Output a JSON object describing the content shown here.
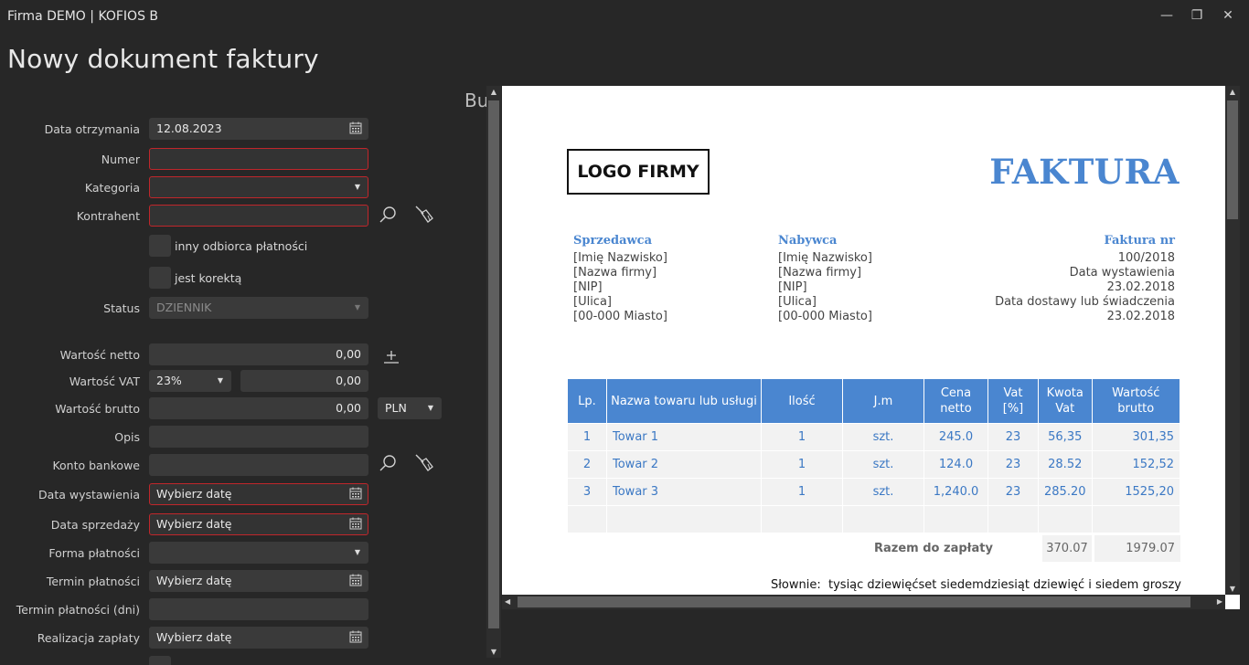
{
  "window": {
    "title": "Firma DEMO | KOFIOS B",
    "minimize": "—",
    "restore": "❐",
    "close": "✕"
  },
  "page": {
    "title": "Nowy dokument faktury",
    "preview_heading": "Bu"
  },
  "form": {
    "data_otrzymania": {
      "label": "Data otrzymania",
      "value": "12.08.2023"
    },
    "numer": {
      "label": "Numer",
      "value": ""
    },
    "kategoria": {
      "label": "Kategoria",
      "value": ""
    },
    "kontrahent": {
      "label": "Kontrahent",
      "value": ""
    },
    "inny_odbiorca": {
      "label": "inny odbiorca płatności"
    },
    "jest_korekta": {
      "label": "jest korektą"
    },
    "status": {
      "label": "Status",
      "value": "DZIENNIK"
    },
    "wartosc_netto": {
      "label": "Wartość netto",
      "value": "0,00"
    },
    "wartosc_vat": {
      "label": "Wartość VAT",
      "rate": "23%",
      "value": "0,00"
    },
    "wartosc_brutto": {
      "label": "Wartość brutto",
      "value": "0,00",
      "currency": "PLN"
    },
    "opis": {
      "label": "Opis",
      "value": ""
    },
    "konto_bankowe": {
      "label": "Konto bankowe",
      "value": ""
    },
    "data_wystawienia": {
      "label": "Data wystawienia",
      "placeholder": "Wybierz datę"
    },
    "data_sprzedazy": {
      "label": "Data sprzedaży",
      "placeholder": "Wybierz datę"
    },
    "forma_platnosci": {
      "label": "Forma płatności",
      "value": ""
    },
    "termin_platnosci": {
      "label": "Termin płatności",
      "placeholder": "Wybierz datę"
    },
    "termin_platnosci_dni": {
      "label": "Termin płatności (dni)",
      "value": ""
    },
    "realizacja_zaplaty": {
      "label": "Realizacja zapłaty",
      "placeholder": "Wybierz datę"
    }
  },
  "invoice": {
    "logo": "LOGO FIRMY",
    "title": "FAKTURA",
    "seller": {
      "heading": "Sprzedawca",
      "lines": [
        "[Imię Nazwisko]",
        "[Nazwa firmy]",
        "[NIP]",
        "[Ulica]",
        "[00-000 Miasto]"
      ]
    },
    "buyer": {
      "heading": "Nabywca",
      "lines": [
        "[Imię Nazwisko]",
        "[Nazwa firmy]",
        "[NIP]",
        "[Ulica]",
        "[00-000 Miasto]"
      ]
    },
    "meta": {
      "heading": "Faktura nr",
      "lines": [
        "100/2018",
        "Data wystawienia",
        "23.02.2018",
        "Data dostawy lub świadczenia",
        "23.02.2018"
      ]
    },
    "columns": [
      "Lp.",
      "Nazwa towaru lub usługi",
      "Ilość",
      "J.m",
      "Cena netto",
      "Vat [%]",
      "Kwota Vat",
      "Wartość brutto"
    ],
    "rows": [
      [
        "1",
        "Towar 1",
        "1",
        "szt.",
        "245.0",
        "23",
        "56,35",
        "301,35"
      ],
      [
        "2",
        "Towar 2",
        "1",
        "szt.",
        "124.0",
        "23",
        "28.52",
        "152,52"
      ],
      [
        "3",
        "Towar 3",
        "1",
        "szt.",
        "1,240.0",
        "23",
        "285.20",
        "1525,20"
      ]
    ],
    "total_label": "Razem do zapłaty",
    "total_vat": "370.07",
    "total_brutto": "1979.07",
    "words_label": "Słownie:",
    "words": "tysiąc dziewięćset siedemdziesiąt dziewięć i siedem groszy"
  },
  "icons": {
    "calendar": "calendar-icon",
    "search": "search-icon",
    "clear": "broom-icon",
    "add": "add-icon"
  }
}
